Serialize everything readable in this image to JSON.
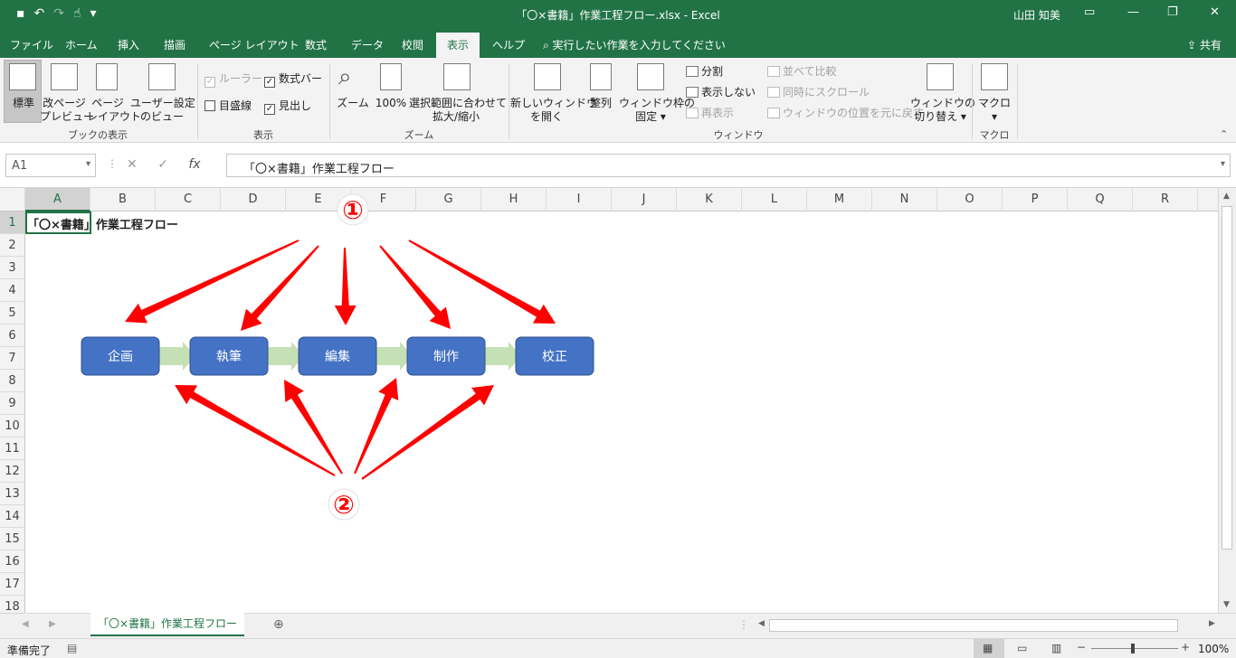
{
  "window": {
    "title": "「〇×書籍」作業工程フロー.xlsx  -  Excel",
    "user": "山田 知美"
  },
  "tabs": [
    "ファイル",
    "ホーム",
    "挿入",
    "描画",
    "ページ レイアウト",
    "数式",
    "データ",
    "校閲",
    "表示",
    "ヘルプ"
  ],
  "tell_me": "実行したい作業を入力してください",
  "share": "共有",
  "ribbon": {
    "workbook_views": {
      "normal": "標準",
      "page_break_preview": [
        "改ページ",
        "プレビュー"
      ],
      "page_layout": [
        "ページ",
        "レイアウト"
      ],
      "custom_views": [
        "ユーザー設定",
        "のビュー"
      ],
      "group": "ブックの表示"
    },
    "show": {
      "ruler": "ルーラー",
      "formula_bar": "数式バー",
      "gridlines": "目盛線",
      "headings": "見出し",
      "group": "表示"
    },
    "zoom": {
      "zoom": "ズーム",
      "hundred": "100%",
      "zoom_selection": [
        "選択範囲に合わせて",
        "拡大/縮小"
      ],
      "group": "ズーム"
    },
    "window": {
      "new_window": [
        "新しいウィンドウ",
        "を開く"
      ],
      "arrange": "整列",
      "freeze": [
        "ウィンドウ枠の",
        "固定"
      ],
      "split": "分割",
      "hide": "表示しない",
      "unhide": "再表示",
      "side_by_side": "並べて比較",
      "sync_scroll": "同時にスクロール",
      "reset_position": "ウィンドウの位置を元に戻す",
      "switch_windows": [
        "ウィンドウの",
        "切り替え"
      ],
      "group": "ウィンドウ"
    },
    "macros": {
      "macros": "マクロ",
      "group": "マクロ"
    }
  },
  "formula_bar": {
    "name_box": "A1",
    "content": "「〇×書籍」作業工程フロー"
  },
  "columns": [
    "A",
    "B",
    "C",
    "D",
    "E",
    "F",
    "G",
    "H",
    "I",
    "J",
    "K",
    "L",
    "M",
    "N",
    "O",
    "P",
    "Q",
    "R"
  ],
  "rows": [
    "1",
    "2",
    "3",
    "4",
    "5",
    "6",
    "7",
    "8",
    "9",
    "10",
    "11",
    "12",
    "13",
    "14",
    "15",
    "16",
    "17",
    "18"
  ],
  "cell_a1": "「〇×書籍」作業工程フロー",
  "flow_steps": [
    "企画",
    "執筆",
    "編集",
    "制作",
    "校正"
  ],
  "callouts": {
    "one": "①",
    "two": "②"
  },
  "sheet_tab": "「〇×書籍」作業工程フロー",
  "status": {
    "ready": "準備完了",
    "zoom": "100%"
  },
  "colors": {
    "excel_green": "#217346",
    "box_fill": "#4472c4",
    "connector": "#c5e0b4",
    "annotation_red": "#ff0000"
  }
}
